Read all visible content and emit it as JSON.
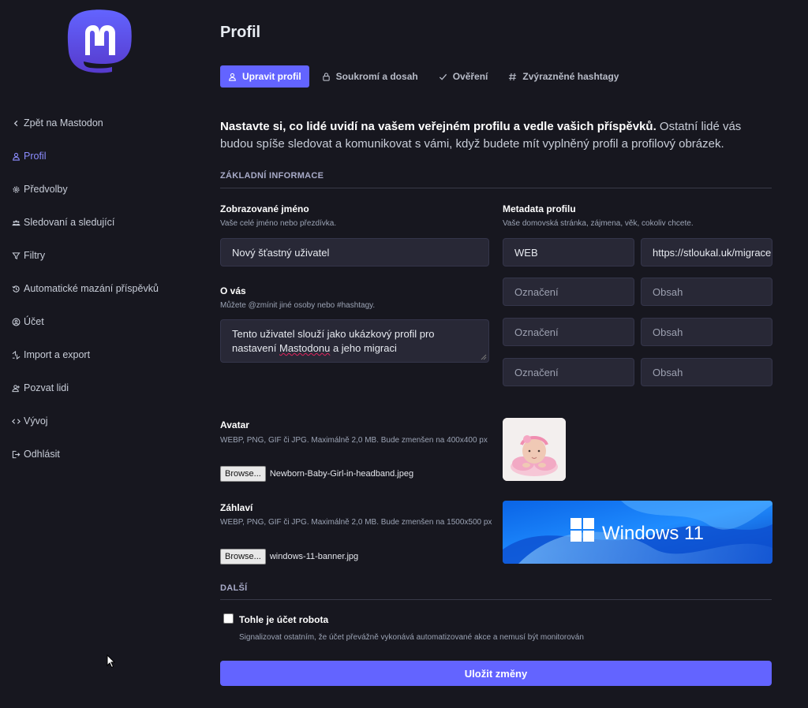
{
  "brand": {
    "accent": "#6364ff",
    "logo_icon": "mastodon-logo"
  },
  "sidebar": {
    "items": [
      {
        "label": "Zpět na Mastodon",
        "icon": "chevron-left-icon"
      },
      {
        "label": "Profil",
        "icon": "person-icon",
        "active": true
      },
      {
        "label": "Předvolby",
        "icon": "gear-icon"
      },
      {
        "label": "Sledovaní a sledující",
        "icon": "people-icon"
      },
      {
        "label": "Filtry",
        "icon": "filter-icon"
      },
      {
        "label": "Automatické mazání příspěvků",
        "icon": "history-icon"
      },
      {
        "label": "Účet",
        "icon": "account-circle-icon"
      },
      {
        "label": "Import a export",
        "icon": "import-export-icon"
      },
      {
        "label": "Pozvat lidi",
        "icon": "person-add-icon"
      },
      {
        "label": "Vývoj",
        "icon": "code-icon"
      },
      {
        "label": "Odhlásit",
        "icon": "logout-icon"
      }
    ]
  },
  "page": {
    "title": "Profil"
  },
  "tabs": [
    {
      "label": "Upravit profil",
      "icon": "person-icon",
      "active": true
    },
    {
      "label": "Soukromí a dosah",
      "icon": "lock-icon"
    },
    {
      "label": "Ověření",
      "icon": "check-icon"
    },
    {
      "label": "Zvýrazněné hashtagy",
      "icon": "hashtag-icon"
    }
  ],
  "intro": {
    "bold": "Nastavte si, co lidé uvidí na vašem veřejném profilu a vedle vašich příspěvků.",
    "rest": " Ostatní lidé vás budou spíše sledovat a komunikovat s vámi, když budete mít vyplněný profil a profilový obrázek."
  },
  "basic": {
    "section_title": "ZÁKLADNÍ INFORMACE",
    "display_name": {
      "label": "Zobrazované jméno",
      "hint": "Vaše celé jméno nebo přezdívka.",
      "value": "Nový šťastný uživatel"
    },
    "bio": {
      "label": "O vás",
      "hint": "Můžete @zmínit jiné osoby nebo #hashtagy.",
      "value_part1": "Tento uživatel slouží jako ukázkový profil pro nastavení ",
      "value_squiggle": "Mastodonu",
      "value_part2": " a jeho migraci"
    },
    "metadata": {
      "label": "Metadata profilu",
      "hint": "Vaše domovská stránka, zájmena, věk, cokoliv chcete.",
      "rows": [
        {
          "name": "WEB",
          "value": "https://stloukal.uk/migrace"
        },
        {
          "name": "",
          "value": ""
        },
        {
          "name": "",
          "value": ""
        },
        {
          "name": "",
          "value": ""
        }
      ],
      "name_placeholder": "Označení",
      "value_placeholder": "Obsah"
    },
    "avatar": {
      "label": "Avatar",
      "hint": "WEBP, PNG, GIF či JPG. Maximálně 2,0 MB. Bude zmenšen na 400x400 px",
      "button": "Browse...",
      "file": "Newborn-Baby-Girl-in-headband.jpeg"
    },
    "header": {
      "label": "Záhlaví",
      "hint": "WEBP, PNG, GIF či JPG. Maximálně 2,0 MB. Bude zmenšen na 1500x500 px",
      "button": "Browse...",
      "file": "windows-11-banner.jpg",
      "banner_text": "Windows 11"
    }
  },
  "other": {
    "section_title": "DALŠÍ",
    "bot": {
      "label": "Tohle je účet robota",
      "hint": "Signalizovat ostatním, že účet převážně vykonává automatizované akce a nemusí být monitorován",
      "checked": false
    }
  },
  "save_label": "Uložit změny"
}
